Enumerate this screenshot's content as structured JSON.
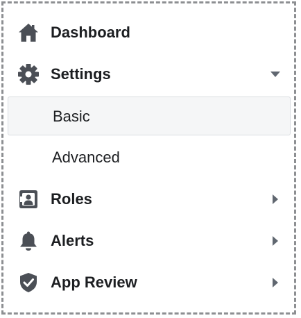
{
  "nav": {
    "items": [
      {
        "label": "Dashboard",
        "icon": "home-icon"
      },
      {
        "label": "Settings",
        "icon": "gear-icon",
        "expanded": true,
        "children": [
          {
            "label": "Basic",
            "selected": true
          },
          {
            "label": "Advanced",
            "selected": false
          }
        ]
      },
      {
        "label": "Roles",
        "icon": "id-badge-icon",
        "expanded": false
      },
      {
        "label": "Alerts",
        "icon": "bell-icon",
        "expanded": false
      },
      {
        "label": "App Review",
        "icon": "shield-check-icon",
        "expanded": false
      }
    ]
  },
  "colors": {
    "text": "#1c1e21",
    "icon": "#4b4f56",
    "caret": "#606770",
    "selected_bg": "#f5f6f7",
    "selected_border": "#dadde1",
    "frame_dash": "#8d8f92"
  }
}
